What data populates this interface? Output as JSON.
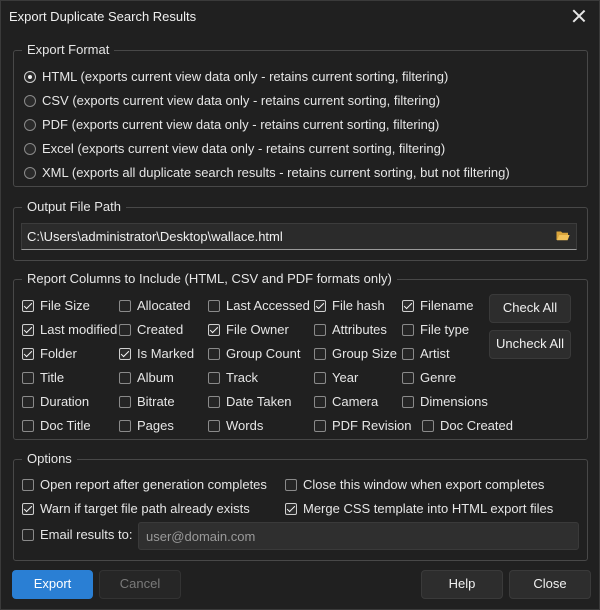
{
  "window": {
    "title": "Export Duplicate Search Results"
  },
  "export_format": {
    "title": "Export Format",
    "options": [
      {
        "label": "HTML (exports current view data only - retains current sorting, filtering)",
        "selected": true
      },
      {
        "label": "CSV (exports current view data only - retains current sorting, filtering)",
        "selected": false
      },
      {
        "label": "PDF (exports current view data only - retains current sorting, filtering)",
        "selected": false
      },
      {
        "label": "Excel (exports current view data only - retains current sorting, filtering)",
        "selected": false
      },
      {
        "label": "XML (exports all duplicate search results - retains current sorting, but not filtering)",
        "selected": false
      }
    ]
  },
  "output": {
    "title": "Output File Path",
    "path": "C:\\Users\\administrator\\Desktop\\wallace.html",
    "browse_icon": "folder-open-icon"
  },
  "columns": {
    "title": "Report Columns to Include (HTML, CSV and PDF formats only)",
    "items": [
      {
        "label": "File Size",
        "checked": true
      },
      {
        "label": "Allocated",
        "checked": false
      },
      {
        "label": "Last Accessed",
        "checked": false
      },
      {
        "label": "File hash",
        "checked": true
      },
      {
        "label": "Filename",
        "checked": true
      },
      {
        "label": "Last modified",
        "checked": true
      },
      {
        "label": "Created",
        "checked": false
      },
      {
        "label": "File Owner",
        "checked": true
      },
      {
        "label": "Attributes",
        "checked": false
      },
      {
        "label": "File type",
        "checked": false
      },
      {
        "label": "Folder",
        "checked": true
      },
      {
        "label": "Is Marked",
        "checked": true
      },
      {
        "label": "Group Count",
        "checked": false
      },
      {
        "label": "Group Size",
        "checked": false
      },
      {
        "label": "Artist",
        "checked": false
      },
      {
        "label": "Title",
        "checked": false
      },
      {
        "label": "Album",
        "checked": false
      },
      {
        "label": "Track",
        "checked": false
      },
      {
        "label": "Year",
        "checked": false
      },
      {
        "label": "Genre",
        "checked": false
      },
      {
        "label": "Duration",
        "checked": false
      },
      {
        "label": "Bitrate",
        "checked": false
      },
      {
        "label": "Date Taken",
        "checked": false
      },
      {
        "label": "Camera",
        "checked": false
      },
      {
        "label": "Dimensions",
        "checked": false
      },
      {
        "label": "Doc Title",
        "checked": false
      },
      {
        "label": "Pages",
        "checked": false
      },
      {
        "label": "Words",
        "checked": false
      },
      {
        "label": "PDF Revision",
        "checked": false
      },
      {
        "label": "Doc Created",
        "checked": false
      }
    ],
    "check_all": "Check All",
    "uncheck_all": "Uncheck All"
  },
  "options": {
    "title": "Options",
    "open_report": {
      "label": "Open report after generation completes",
      "checked": false
    },
    "close_window": {
      "label": "Close this window when export completes",
      "checked": false
    },
    "warn_exists": {
      "label": "Warn if target file path already exists",
      "checked": true
    },
    "merge_css": {
      "label": "Merge CSS template into HTML export files",
      "checked": true
    },
    "email": {
      "label": "Email results to:",
      "checked": false,
      "placeholder": "user@domain.com"
    }
  },
  "buttons": {
    "export": "Export",
    "cancel": "Cancel",
    "help": "Help",
    "close": "Close"
  },
  "colors": {
    "accent": "#2a7fd4",
    "background": "#202020"
  }
}
